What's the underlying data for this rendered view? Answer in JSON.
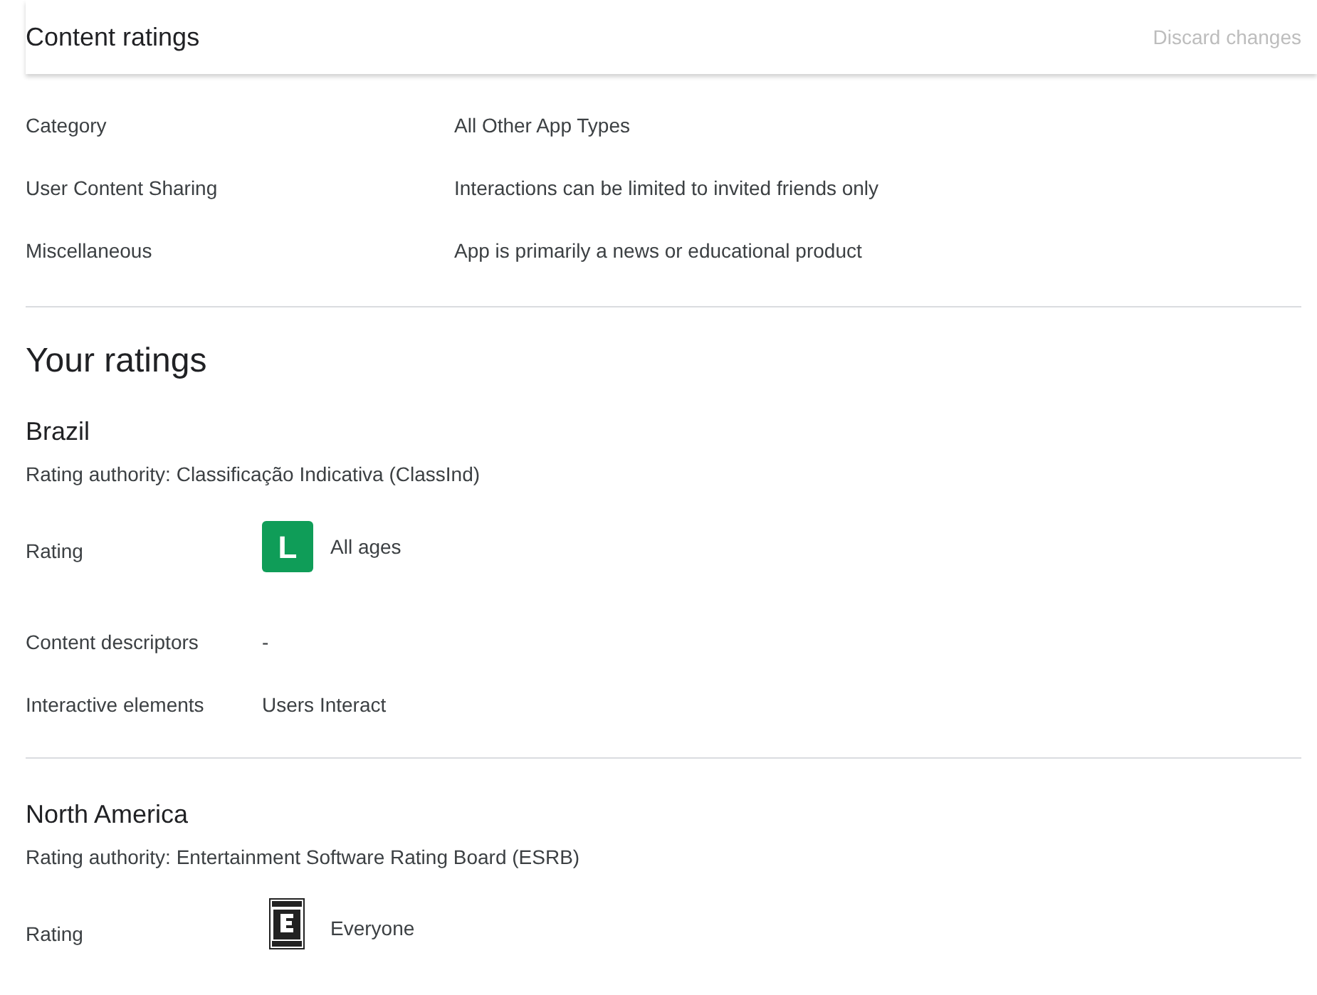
{
  "header": {
    "title": "Content ratings",
    "discard_button": "Discard changes"
  },
  "questionnaire": [
    {
      "label": "Category",
      "value": "All Other App Types"
    },
    {
      "label": "User Content Sharing",
      "value": "Interactions can be limited to invited friends only"
    },
    {
      "label": "Miscellaneous",
      "value": "App is primarily a news or educational product"
    }
  ],
  "ratings_title": "Your ratings",
  "regions": [
    {
      "name": "Brazil",
      "authority": "Rating authority: Classificação Indicativa (ClassInd)",
      "rows": [
        {
          "label": "Rating",
          "kind": "badge",
          "badge": {
            "kind": "classind",
            "letter": "L",
            "color": "#0f9d58"
          },
          "value": "All ages"
        },
        {
          "label": "Content descriptors",
          "kind": "text",
          "value": "-"
        },
        {
          "label": "Interactive elements",
          "kind": "text",
          "value": "Users Interact"
        }
      ]
    },
    {
      "name": "North America",
      "authority": "Rating authority: Entertainment Software Rating Board (ESRB)",
      "rows": [
        {
          "label": "Rating",
          "kind": "badge",
          "badge": {
            "kind": "esrb"
          },
          "value": "Everyone"
        }
      ]
    }
  ]
}
